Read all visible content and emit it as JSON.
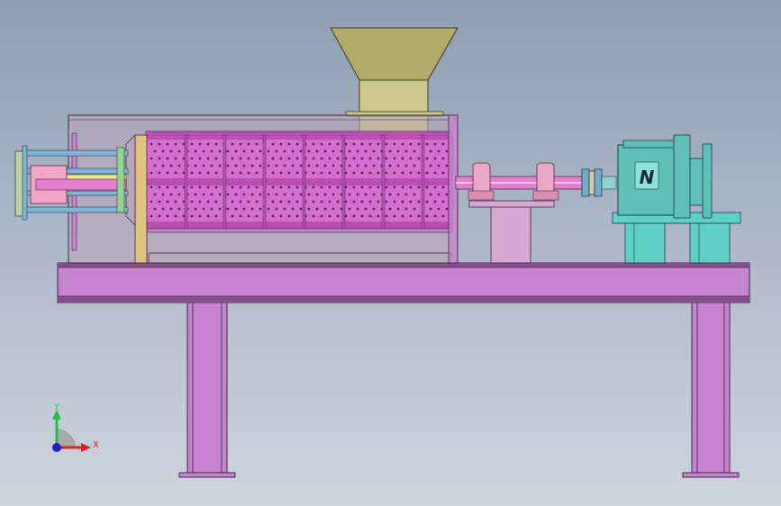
{
  "viewport": {
    "background_top": "#8f9eb2",
    "background_bottom": "#cfd5df"
  },
  "colors": {
    "frame": "#c683cf",
    "frame_dark": "#8a4c93",
    "screen_body": "#d56fcf",
    "screen_band": "#b94fb3",
    "shaft": "#e27fcf",
    "hopper": "#b0ab6b",
    "hopper_throat": "#cdc98c",
    "gearbox": "#5fc0b8",
    "gearbox_stand": "#5fd0c8",
    "pedestal": "#d7a7d6",
    "tan_plate": "#e0c27f",
    "housing_glass": "#b9a6b9",
    "blue_rod": "#7fb4d6"
  },
  "gearbox": {
    "logo_letter": "N"
  },
  "triad": {
    "x_label": "X",
    "y_label": "Y",
    "x_color": "#e02020",
    "y_color": "#20c040",
    "z_color": "#2020d0"
  },
  "icons": {
    "axis_triad": "coordinate-triad-icon",
    "gearbox_logo": "logo-n-icon"
  }
}
